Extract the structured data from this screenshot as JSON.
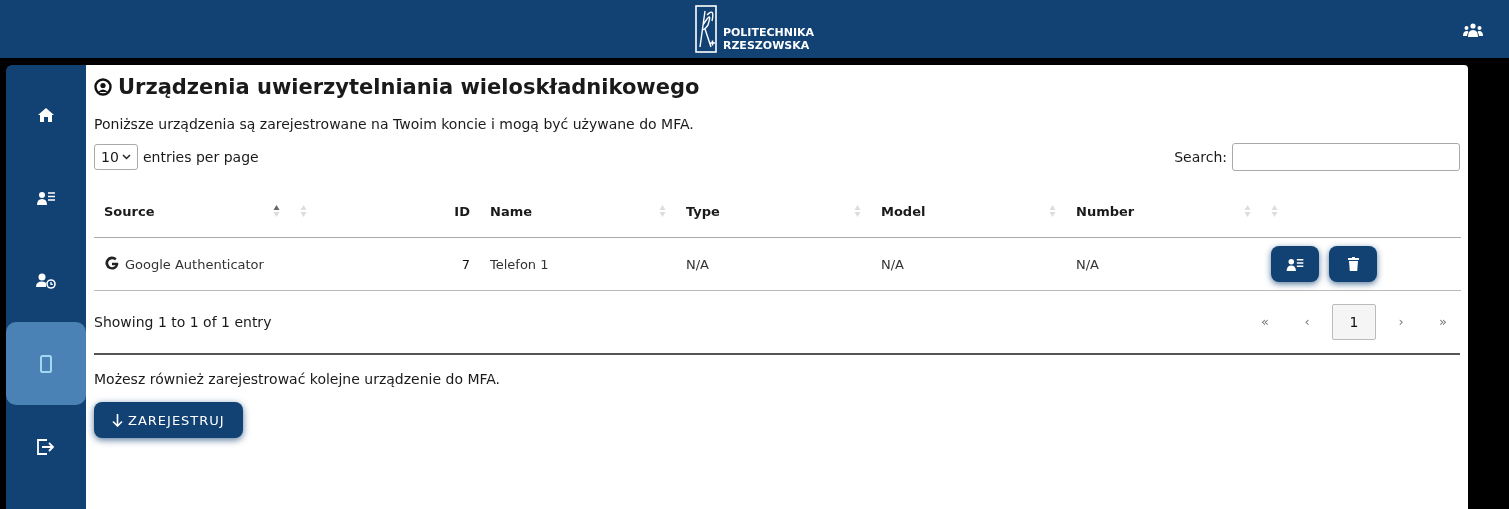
{
  "header": {
    "logo_lines": [
      "POLITECHNIKA",
      "RZESZOWSKA"
    ]
  },
  "sidebar": {
    "items": [
      {
        "kind": "home",
        "selected": false
      },
      {
        "kind": "user-list",
        "selected": false
      },
      {
        "kind": "user-clock",
        "selected": false
      },
      {
        "kind": "phone",
        "selected": true
      },
      {
        "kind": "logout",
        "selected": false
      }
    ]
  },
  "page": {
    "title": "Urządzenia uwierzytelniania wieloskładnikowego",
    "intro": "Poniższe urządzenia są zarejestrowane na Twoim koncie i mogą być używane do MFA.",
    "page_size": {
      "value": "10",
      "suffix": "entries per page"
    },
    "search": {
      "label": "Search:"
    },
    "table": {
      "columns": [
        {
          "label": "Source",
          "sorted": true
        },
        {
          "sorted": false
        },
        {
          "label": "ID"
        },
        {
          "label": "Name",
          "sorted": false
        },
        {
          "label": "Type",
          "sorted": false
        },
        {
          "label": "Model",
          "sorted": false
        },
        {
          "label": "Number",
          "sorted": false
        },
        {
          "sorted": false
        }
      ],
      "rows": [
        {
          "source": "Google Authenticator",
          "id": "7",
          "name": "Telefon 1",
          "type": "N/A",
          "model": "N/A",
          "number": "N/A"
        }
      ]
    },
    "info": "Showing 1 to 1 of 1 entry",
    "pagination": {
      "first": "«",
      "prev": "‹",
      "pages": [
        {
          "label": "1",
          "selected": true
        }
      ],
      "next": "›",
      "last": "»"
    },
    "register_text": "Możesz również zarejestrować kolejne urządzenie do MFA.",
    "register_button": "ZAREJESTRUJ"
  }
}
